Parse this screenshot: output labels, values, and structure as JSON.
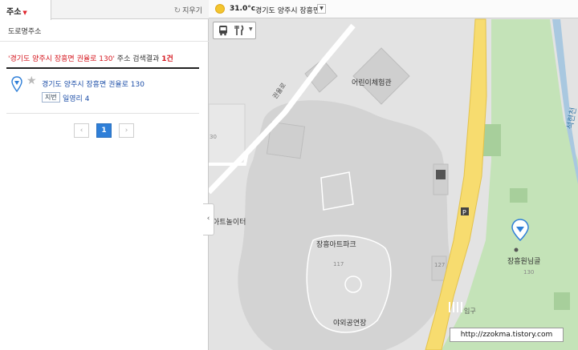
{
  "left_panel": {
    "tab_label": "주소",
    "clear_label": "지우기",
    "road_address_label": "도로명주소",
    "result": {
      "query": "'경기도 양주시 장흥면 권율로 130'",
      "suffix": " 주소 검색결과 ",
      "count": "1건"
    },
    "item": {
      "address": "경기도 양주시 장흥면 권율로 130",
      "jibun_label": "지번",
      "jibun_address": "일영리 4"
    },
    "pagination": {
      "prev": "‹",
      "current": "1",
      "next": "›"
    }
  },
  "map": {
    "weather": {
      "temperature": "31.0°c",
      "region": "경기도 양주시 장흥면"
    },
    "labels": {
      "kids_hall": "어린이체험관",
      "art_playground": "아트놀이터",
      "art_park": "장흥아트파크",
      "outdoor_stage": "야외공연장",
      "rest_area": "장흥원님골",
      "entrance": "입구",
      "road_name": "권율로",
      "stream": "석현천",
      "num_117": "117",
      "num_127": "127",
      "num_130": "130",
      "num_30": "30"
    },
    "colors": {
      "background": "#e3e3e3",
      "road": "#f7dc6f",
      "park": "#bfe0b5",
      "water": "#a9c8e0"
    }
  },
  "watermark": "http://zzokma.tistory.com"
}
